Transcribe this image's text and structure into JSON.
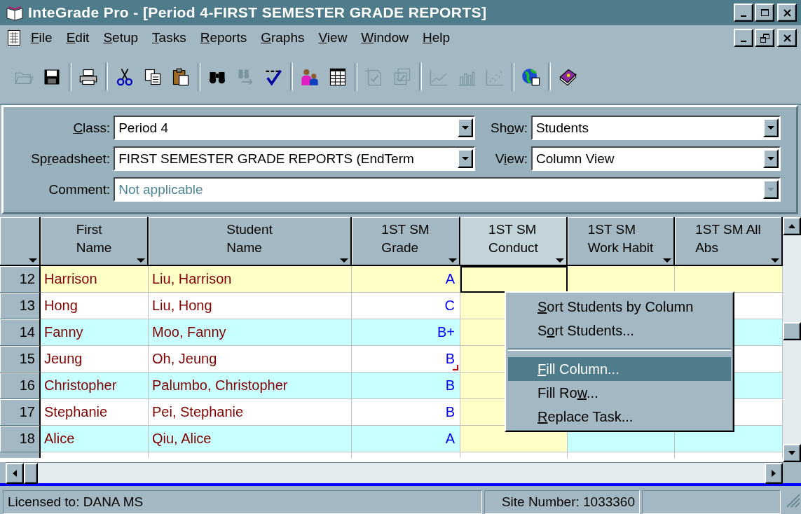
{
  "window": {
    "title": "InteGrade Pro - [Period 4-FIRST SEMESTER GRADE REPORTS]"
  },
  "menu": [
    {
      "key": "F",
      "after": "ile"
    },
    {
      "key": "E",
      "after": "dit"
    },
    {
      "key": "S",
      "after": "etup"
    },
    {
      "key": "T",
      "after": "asks"
    },
    {
      "key": "R",
      "after": "eports"
    },
    {
      "key": "G",
      "after": "raphs"
    },
    {
      "key": "V",
      "after": "iew"
    },
    {
      "key": "W",
      "after": "indow"
    },
    {
      "key": "H",
      "after": "elp"
    }
  ],
  "toolbar": {
    "groups": [
      [
        {
          "kind": "open",
          "disabled": true
        },
        {
          "kind": "save",
          "disabled": false
        }
      ],
      [
        {
          "kind": "print",
          "disabled": false
        }
      ],
      [
        {
          "kind": "cut",
          "disabled": false
        },
        {
          "kind": "copy",
          "disabled": false
        },
        {
          "kind": "paste",
          "disabled": false
        }
      ],
      [
        {
          "kind": "find",
          "disabled": false
        },
        {
          "kind": "find-next",
          "disabled": true
        },
        {
          "kind": "spell",
          "disabled": false
        }
      ],
      [
        {
          "kind": "people",
          "disabled": false
        },
        {
          "kind": "table",
          "disabled": false
        }
      ],
      [
        {
          "kind": "new-doc",
          "disabled": true
        },
        {
          "kind": "docs",
          "disabled": true
        }
      ],
      [
        {
          "kind": "line-chart",
          "disabled": true
        },
        {
          "kind": "bar-chart",
          "disabled": true
        },
        {
          "kind": "scatter-chart",
          "disabled": true
        }
      ],
      [
        {
          "kind": "globe",
          "disabled": false
        }
      ],
      [
        {
          "kind": "book",
          "disabled": false
        }
      ]
    ]
  },
  "form": {
    "rows": [
      [
        {
          "label": {
            "key": "C",
            "after": "lass:"
          },
          "value": "Period 4",
          "disabled": false
        },
        {
          "label": {
            "before": "Sh",
            "key": "o",
            "after": "w:"
          },
          "value": "Students",
          "disabled": false
        }
      ],
      [
        {
          "label": {
            "before": "Sp",
            "key": "r",
            "after": "eadsheet:"
          },
          "value": "FIRST SEMESTER GRADE REPORTS (EndTerm",
          "disabled": false
        },
        {
          "label": {
            "before": "V",
            "key": "i",
            "after": "ew:"
          },
          "value": "Column View",
          "disabled": false
        }
      ],
      [
        {
          "label": {
            "text": "Comment:"
          },
          "value": "Not applicable",
          "disabled": true
        }
      ]
    ]
  },
  "grid": {
    "columns": [
      {
        "lines": [
          "First",
          "Name"
        ],
        "selected": false
      },
      {
        "lines": [
          "Student",
          "Name"
        ],
        "selected": false
      },
      {
        "lines": [
          "1ST SM",
          "Grade"
        ],
        "selected": false
      },
      {
        "lines": [
          "1ST SM",
          "Conduct"
        ],
        "selected": true
      },
      {
        "lines": [
          "1ST SM",
          "Work Habit"
        ],
        "selected": false
      },
      {
        "lines": [
          "1ST SM All",
          "Abs"
        ],
        "selected": false
      }
    ],
    "rows": [
      {
        "number": "12",
        "selected": true,
        "grade_note": false,
        "cells": [
          "Harrison",
          "Liu, Harrison",
          "A"
        ]
      },
      {
        "number": "13",
        "selected": false,
        "grade_note": false,
        "cells": [
          "Hong",
          "Liu, Hong",
          "C"
        ]
      },
      {
        "number": "14",
        "selected": false,
        "grade_note": false,
        "cells": [
          "Fanny",
          "Moo, Fanny",
          "B+"
        ]
      },
      {
        "number": "15",
        "selected": false,
        "grade_note": true,
        "cells": [
          "Jeung",
          "Oh, Jeung",
          "B"
        ]
      },
      {
        "number": "16",
        "selected": false,
        "grade_note": false,
        "cells": [
          "Christopher",
          "Palumbo, Christopher",
          "B"
        ]
      },
      {
        "number": "17",
        "selected": false,
        "grade_note": false,
        "cells": [
          "Stephanie",
          "Pei, Stephanie",
          "B"
        ]
      },
      {
        "number": "18",
        "selected": false,
        "grade_note": false,
        "cells": [
          "Alice",
          "Qiu, Alice",
          "A"
        ]
      }
    ]
  },
  "context_menu": {
    "items": [
      {
        "kind": "item",
        "label": {
          "key": "S",
          "after": "ort Students by Column"
        },
        "selected": false
      },
      {
        "kind": "item",
        "label": {
          "before": "S",
          "key": "o",
          "after": "rt Students..."
        },
        "selected": false
      },
      {
        "kind": "separator"
      },
      {
        "kind": "item",
        "label": {
          "key": "F",
          "after": "ill Column..."
        },
        "selected": true
      },
      {
        "kind": "item",
        "label": {
          "before": "Fill Ro",
          "key": "w",
          "after": "..."
        },
        "selected": false
      },
      {
        "kind": "item",
        "label": {
          "key": "R",
          "after": "eplace Task..."
        },
        "selected": false
      }
    ]
  },
  "status_bar": {
    "panels": [
      "Licensed to: DANA MS",
      "Site Number: 1033360"
    ]
  }
}
